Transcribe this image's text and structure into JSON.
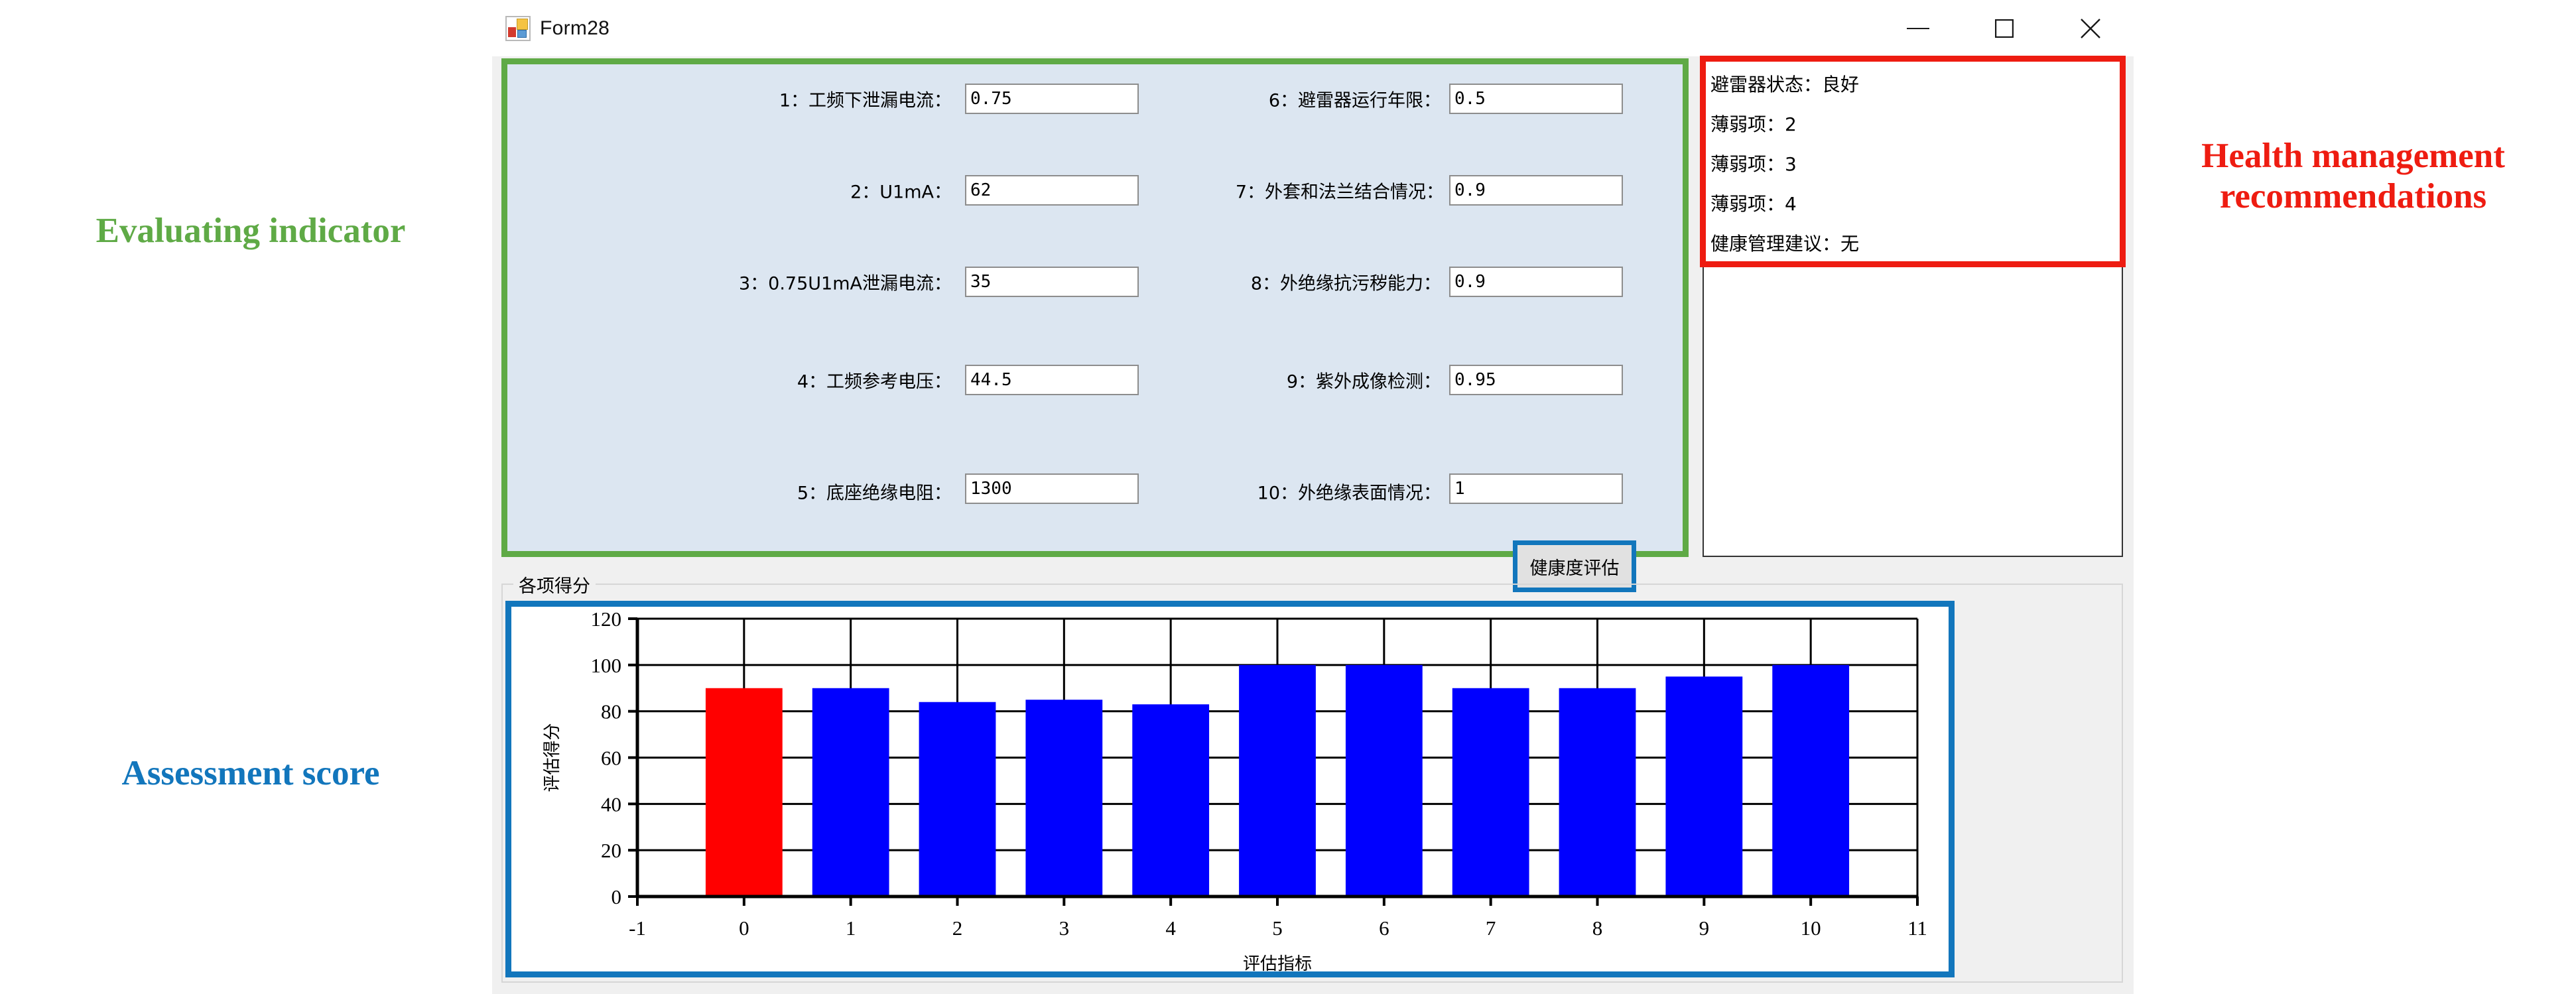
{
  "window": {
    "title": "Form28",
    "icon": "form-designer-icon",
    "controls": {
      "minimize": "minimize-icon",
      "maximize": "maximize-icon",
      "close": "close-icon"
    }
  },
  "annotations": {
    "evaluating_indicator": "Evaluating indicator",
    "health_management": "Health management\nrecommendations",
    "assessment_score": "Assessment score",
    "colors": {
      "evaluating_indicator": "#5faa46",
      "health_management": "#ee1c11",
      "assessment_score": "#1276bc"
    }
  },
  "eval_panel": {
    "border_color": "#5faa46",
    "background": "#dce6f1",
    "fields": [
      {
        "label": "1：工频下泄漏电流：",
        "value": "0.75"
      },
      {
        "label": "2：U1mA：",
        "value": "62"
      },
      {
        "label": "3：0.75U1mA泄漏电流：",
        "value": "35"
      },
      {
        "label": "4：工频参考电压：",
        "value": "44.5"
      },
      {
        "label": "5：底座绝缘电阻：",
        "value": "1300"
      },
      {
        "label": "6：避雷器运行年限：",
        "value": "0.5"
      },
      {
        "label": "7：外套和法兰结合情况：",
        "value": "0.9"
      },
      {
        "label": "8：外绝缘抗污秽能力：",
        "value": "0.9"
      },
      {
        "label": "9：紫外成像检测：",
        "value": "0.95"
      },
      {
        "label": "10：外绝缘表面情况：",
        "value": "1"
      }
    ],
    "assess_button": "健康度评估"
  },
  "recommendation_box": {
    "highlight_color": "#ee1c11",
    "lines": [
      "避雷器状态：良好",
      "薄弱项：2",
      "薄弱项：3",
      "薄弱项：4",
      "健康管理建议：无"
    ]
  },
  "chart_group": {
    "caption": "各项得分",
    "border_color": "#1276bc"
  },
  "chart_data": {
    "type": "bar",
    "title": "",
    "xlabel": "评估指标",
    "ylabel": "评估得分",
    "categories": [
      0,
      1,
      2,
      3,
      4,
      5,
      6,
      7,
      8,
      9,
      10
    ],
    "values": [
      90,
      90,
      84,
      85,
      83,
      100,
      100,
      90,
      90,
      95,
      100
    ],
    "bar_colors": [
      "#ff0000",
      "#0000ff",
      "#0000ff",
      "#0000ff",
      "#0000ff",
      "#0000ff",
      "#0000ff",
      "#0000ff",
      "#0000ff",
      "#0000ff",
      "#0000ff"
    ],
    "xlim": [
      -1,
      11
    ],
    "ylim": [
      0,
      120
    ],
    "xticks": [
      -1,
      0,
      1,
      2,
      3,
      4,
      5,
      6,
      7,
      8,
      9,
      10,
      11
    ],
    "yticks": [
      0,
      20,
      40,
      60,
      80,
      100,
      120
    ],
    "grid": true,
    "legend": "none"
  }
}
